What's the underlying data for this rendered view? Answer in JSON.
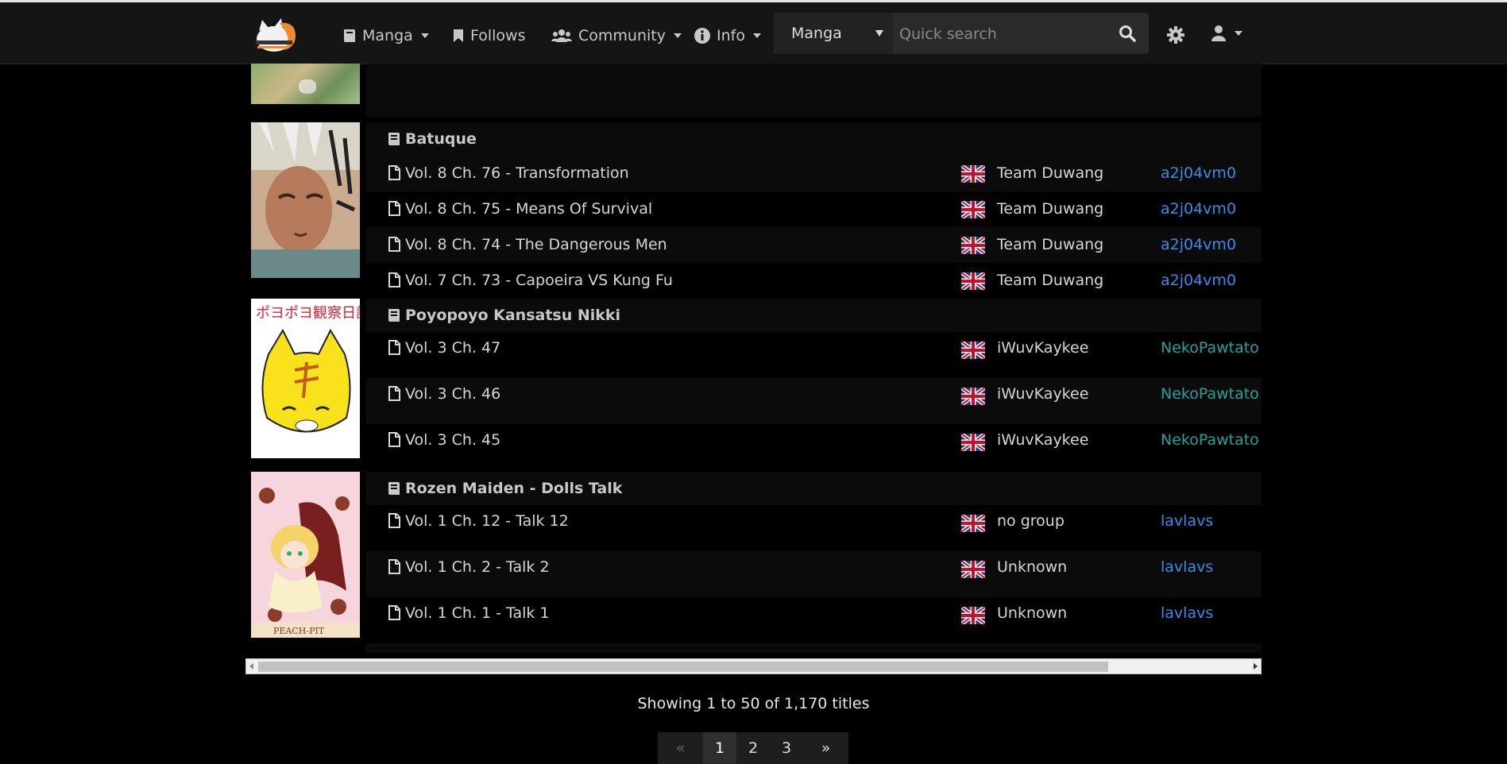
{
  "nav": {
    "manga": "Manga",
    "follows": "Follows",
    "community": "Community",
    "info": "Info",
    "search_type": "Manga",
    "search_placeholder": "Quick search"
  },
  "manga_list": [
    {
      "title": "Batuque",
      "chapters": [
        {
          "title": "Vol. 8 Ch. 76 - Transformation",
          "group": "Team Duwang",
          "uploader": "a2j04vm0"
        },
        {
          "title": "Vol. 8 Ch. 75 - Means Of Survival",
          "group": "Team Duwang",
          "uploader": "a2j04vm0"
        },
        {
          "title": "Vol. 8 Ch. 74 - The Dangerous Men",
          "group": "Team Duwang",
          "uploader": "a2j04vm0"
        },
        {
          "title": "Vol. 7 Ch. 73 - Capoeira VS Kung Fu",
          "group": "Team Duwang",
          "uploader": "a2j04vm0"
        }
      ]
    },
    {
      "title": "Poyopoyo Kansatsu Nikki",
      "chapters": [
        {
          "title": "Vol. 3 Ch. 47",
          "group": "iWuvKaykee",
          "uploader": "NekoPawtato"
        },
        {
          "title": "Vol. 3 Ch. 46",
          "group": "iWuvKaykee",
          "uploader": "NekoPawtato"
        },
        {
          "title": "Vol. 3 Ch. 45",
          "group": "iWuvKaykee",
          "uploader": "NekoPawtato"
        }
      ]
    },
    {
      "title": "Rozen Maiden - Dolls Talk",
      "chapters": [
        {
          "title": "Vol. 1 Ch. 12 - Talk 12",
          "group": "no group",
          "uploader": "lavlavs"
        },
        {
          "title": "Vol. 1 Ch. 2 - Talk 2",
          "group": "Unknown",
          "uploader": "lavlavs"
        },
        {
          "title": "Vol. 1 Ch. 1 - Talk 1",
          "group": "Unknown",
          "uploader": "lavlavs"
        }
      ]
    }
  ],
  "showing_text": "Showing 1 to 50 of 1,170 titles",
  "pagination": {
    "first": "«",
    "pages": [
      "1",
      "2",
      "3"
    ],
    "last": "»",
    "current": "1"
  },
  "colors": {
    "uploader_blue": "#3b8beb",
    "uploader_teal": "#2aa198"
  }
}
